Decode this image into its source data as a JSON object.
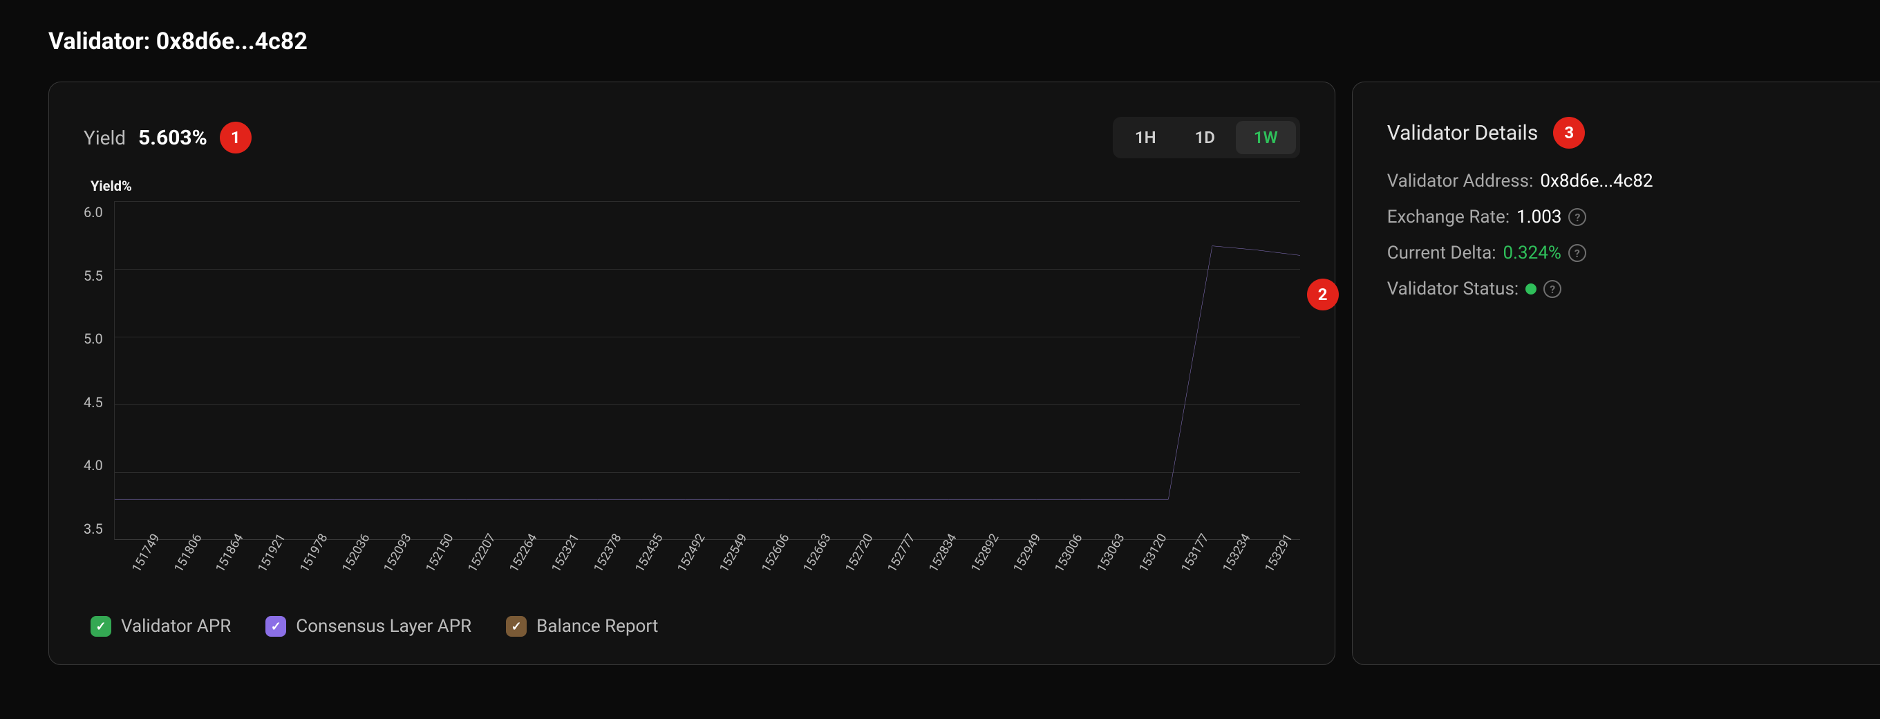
{
  "page": {
    "title": "Validator: 0x8d6e...4c82"
  },
  "badges": {
    "one": "1",
    "two": "2",
    "three": "3"
  },
  "yield": {
    "label": "Yield",
    "value": "5.603%"
  },
  "range": {
    "options": [
      "1H",
      "1D",
      "1W"
    ],
    "active": "1W"
  },
  "chart": {
    "y_title": "Yield%",
    "y_ticks": [
      "6.0",
      "5.5",
      "5.0",
      "4.5",
      "4.0",
      "3.5"
    ],
    "x_ticks": [
      "151749",
      "151806",
      "151864",
      "151921",
      "151978",
      "152036",
      "152093",
      "152150",
      "152207",
      "152264",
      "152321",
      "152378",
      "152435",
      "152492",
      "152549",
      "152606",
      "152663",
      "152720",
      "152777",
      "152834",
      "152892",
      "152949",
      "153006",
      "153063",
      "153120",
      "153177",
      "153234",
      "153291"
    ]
  },
  "legend": {
    "validator_apr": "Validator APR",
    "consensus_layer_apr": "Consensus Layer APR",
    "balance_report": "Balance Report"
  },
  "details": {
    "title": "Validator Details",
    "address_label": "Validator Address:",
    "address_value": "0x8d6e...4c82",
    "exchange_label": "Exchange Rate:",
    "exchange_value": "1.003",
    "delta_label": "Current Delta:",
    "delta_value": "0.324%",
    "status_label": "Validator Status:",
    "help": "?"
  },
  "icons": {
    "check": "✓"
  },
  "chart_data": {
    "type": "line",
    "title": "Yield%",
    "xlabel": "",
    "ylabel": "Yield%",
    "ylim": [
      3.5,
      6.0
    ],
    "categories": [
      "151749",
      "151806",
      "151864",
      "151921",
      "151978",
      "152036",
      "152093",
      "152150",
      "152207",
      "152264",
      "152321",
      "152378",
      "152435",
      "152492",
      "152549",
      "152606",
      "152663",
      "152720",
      "152777",
      "152834",
      "152892",
      "152949",
      "153006",
      "153063",
      "153120",
      "153177",
      "153234",
      "153291"
    ],
    "series": [
      {
        "name": "Consensus Layer APR",
        "color": "#9b85e0",
        "values": [
          3.8,
          3.8,
          3.8,
          3.8,
          3.8,
          3.8,
          3.8,
          3.8,
          3.8,
          3.8,
          3.8,
          3.8,
          3.8,
          3.8,
          3.8,
          3.8,
          3.8,
          3.8,
          3.8,
          3.8,
          3.8,
          3.8,
          3.8,
          3.8,
          3.8,
          5.67,
          5.64,
          5.6
        ]
      }
    ],
    "legend_entries": [
      "Validator APR",
      "Consensus Layer APR",
      "Balance Report"
    ]
  }
}
